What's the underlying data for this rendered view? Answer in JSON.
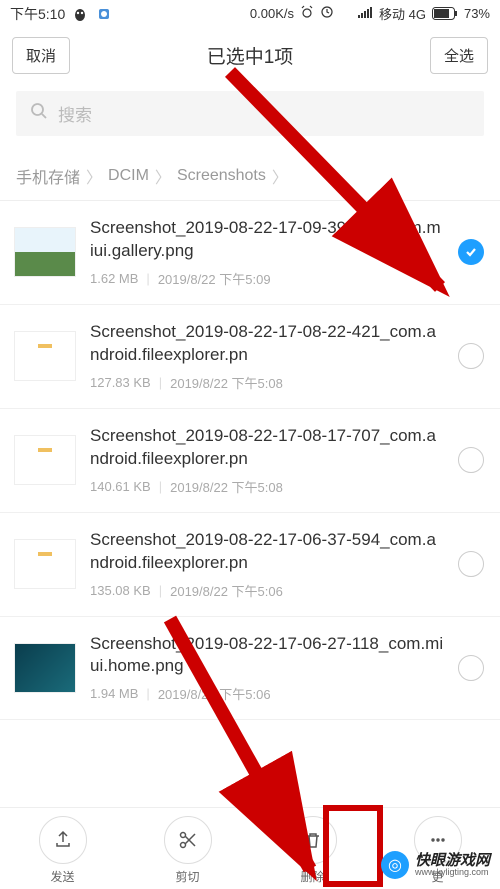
{
  "status_bar": {
    "time": "下午5:10",
    "net_speed": "0.00K/s",
    "carrier": "移动 4G",
    "battery": "73%"
  },
  "header": {
    "cancel": "取消",
    "title": "已选中1项",
    "select_all": "全选"
  },
  "search": {
    "placeholder": "搜索"
  },
  "breadcrumb": {
    "a": "手机存储",
    "b": "DCIM",
    "c": "Screenshots"
  },
  "files": [
    {
      "name": "Screenshot_2019-08-22-17-09-39-608_com.miui.gallery.png",
      "size": "1.62 MB",
      "date": "2019/8/22 下午5:09",
      "selected": true
    },
    {
      "name": "Screenshot_2019-08-22-17-08-22-421_com.android.fileexplorer.pn",
      "size": "127.83 KB",
      "date": "2019/8/22 下午5:08",
      "selected": false
    },
    {
      "name": "Screenshot_2019-08-22-17-08-17-707_com.android.fileexplorer.pn",
      "size": "140.61 KB",
      "date": "2019/8/22 下午5:08",
      "selected": false
    },
    {
      "name": "Screenshot_2019-08-22-17-06-37-594_com.android.fileexplorer.pn",
      "size": "135.08 KB",
      "date": "2019/8/22 下午5:06",
      "selected": false
    },
    {
      "name": "Screenshot_2019-08-22-17-06-27-118_com.miui.home.png",
      "size": "1.94 MB",
      "date": "2019/8/22 下午5:06",
      "selected": false
    }
  ],
  "bottom": {
    "send": "发送",
    "cut": "剪切",
    "delete": "删除",
    "more": "更"
  },
  "watermark": {
    "main": "快眼游戏网",
    "sub": "www.kyligting.com"
  }
}
